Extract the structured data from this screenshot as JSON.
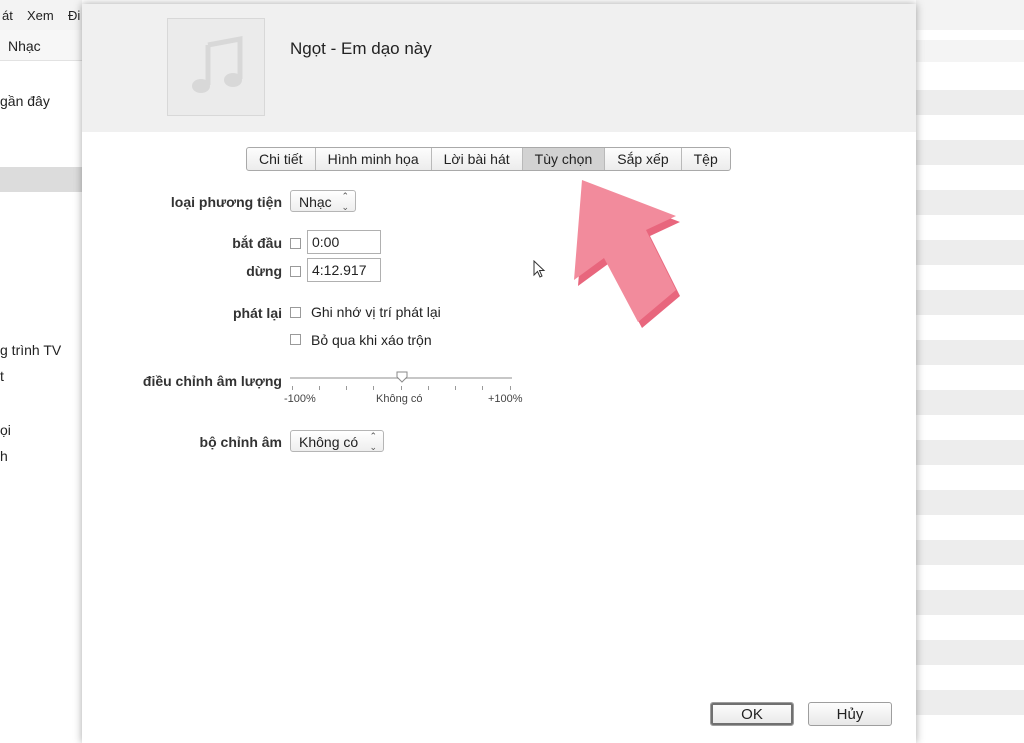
{
  "background": {
    "menu": [
      "át",
      "Xem",
      "Đi"
    ],
    "subtab": "Nhạc",
    "sidebar": [
      "gần đây",
      "g trình TV",
      "t",
      "ọi",
      "h"
    ]
  },
  "dialog": {
    "title": "Ngọt - Em dạo này",
    "tabs": [
      {
        "label": "Chi tiết"
      },
      {
        "label": "Hình minh họa"
      },
      {
        "label": "Lời bài hát"
      },
      {
        "label": "Tùy chọn",
        "active": true
      },
      {
        "label": "Sắp xếp"
      },
      {
        "label": "Tệp"
      }
    ],
    "media_kind": {
      "label": "loại phương tiện",
      "value": "Nhạc"
    },
    "start": {
      "label": "bắt đầu",
      "checked": false,
      "value": "0:00"
    },
    "stop": {
      "label": "dừng",
      "checked": false,
      "value": "4:12.917"
    },
    "playback": {
      "label": "phát lại",
      "remember_position": "Ghi nhớ vị trí phát lại",
      "skip_shuffle": "Bỏ qua khi xáo trộn"
    },
    "volume": {
      "label": "điều chỉnh âm lượng",
      "min_label": "-100%",
      "mid_label": "Không có",
      "max_label": "+100%",
      "value_percent": 0
    },
    "equalizer": {
      "label": "bộ chỉnh âm",
      "value": "Không có"
    },
    "buttons": {
      "ok": "OK",
      "cancel": "Hủy"
    }
  },
  "colors": {
    "overlay_arrow": "#f28b9c",
    "overlay_arrow_shadow": "#e8667d"
  }
}
